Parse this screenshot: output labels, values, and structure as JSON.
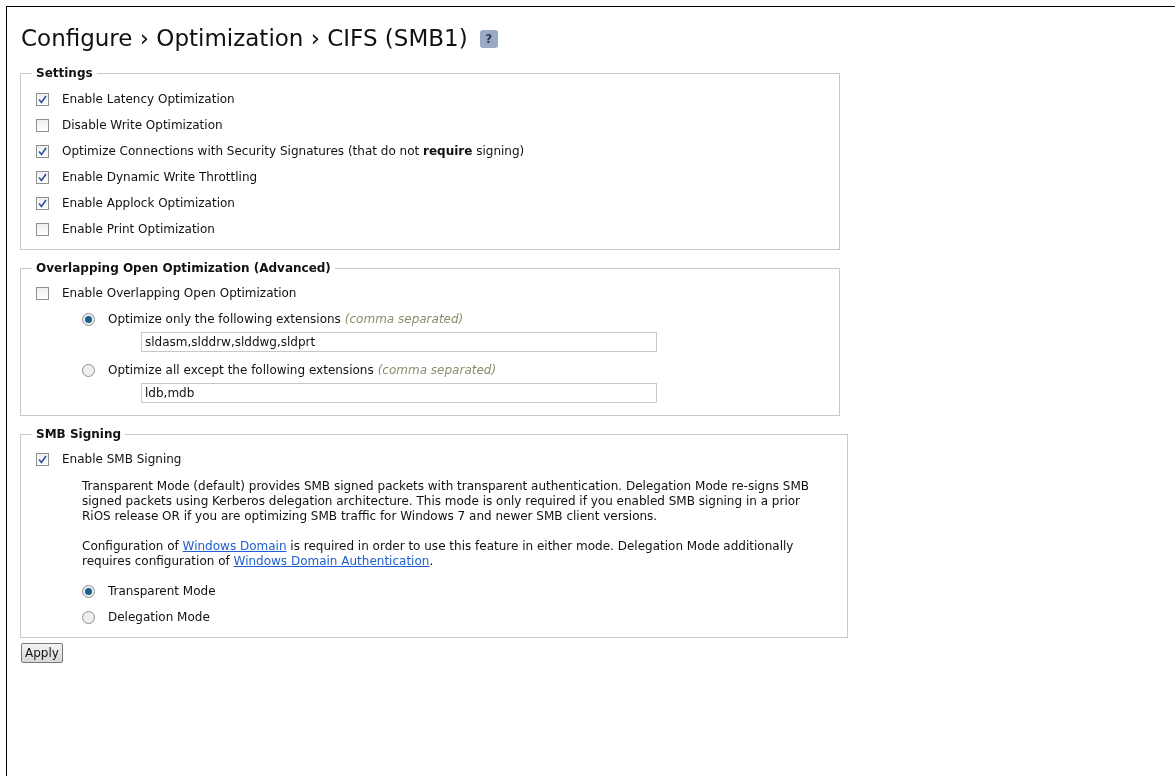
{
  "title": "Configure › Optimization › CIFS (SMB1)",
  "help": "?",
  "settings": {
    "legend": "Settings",
    "items": [
      {
        "label": "Enable Latency Optimization",
        "checked": true
      },
      {
        "label": "Disable Write Optimization",
        "checked": false
      },
      {
        "label": "Optimize Connections with Security Signatures (that do not **require** signing)",
        "checked": true
      },
      {
        "label": "Enable Dynamic Write Throttling",
        "checked": true
      },
      {
        "label": "Enable Applock Optimization",
        "checked": true
      },
      {
        "label": "Enable Print Optimization",
        "checked": false
      }
    ]
  },
  "overlapping": {
    "legend": "Overlapping Open Optimization (Advanced)",
    "enable": {
      "label": "Enable Overlapping Open Optimization",
      "checked": false
    },
    "options": [
      {
        "label": "Optimize only the following extensions",
        "hint": "(comma separated)",
        "selected": true,
        "value": "sldasm,slddrw,slddwg,sldprt"
      },
      {
        "label": "Optimize all except the following extensions",
        "hint": "(comma separated)",
        "selected": false,
        "value": "ldb,mdb"
      }
    ]
  },
  "smb_signing": {
    "legend": "SMB Signing",
    "enable": {
      "label": "Enable SMB Signing",
      "checked": true
    },
    "description": "Transparent Mode (default) provides SMB signed packets with transparent authentication. Delegation Mode re-signs SMB signed packets using Kerberos delegation architecture. This mode is only required if you enabled SMB signing in a prior RiOS release OR if you are optimizing SMB traffic for Windows 7 and newer SMB client versions.",
    "note": [
      {
        "kind": "text",
        "text": "Configuration of "
      },
      {
        "kind": "link",
        "text": "Windows Domain"
      },
      {
        "kind": "text",
        "text": " is required in order to use this feature in either mode. Delegation Mode additionally requires configuration of "
      },
      {
        "kind": "link",
        "text": "Windows Domain Authentication"
      },
      {
        "kind": "text",
        "text": "."
      }
    ],
    "modes": [
      {
        "label": "Transparent Mode",
        "selected": true
      },
      {
        "label": "Delegation Mode",
        "selected": false
      }
    ]
  },
  "apply": "Apply"
}
